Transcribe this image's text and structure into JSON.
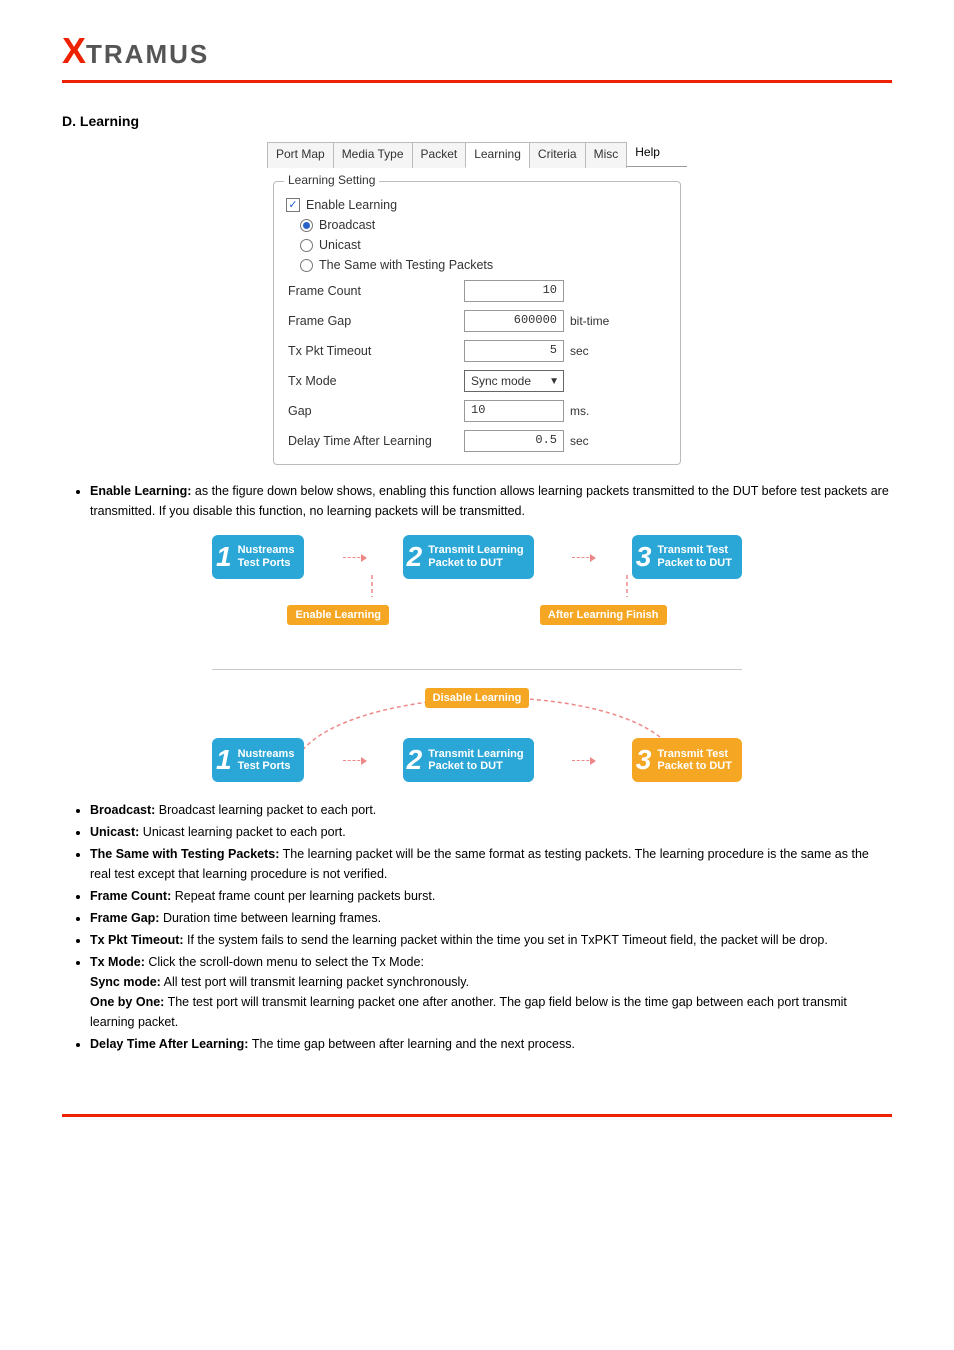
{
  "logo": {
    "x": "X",
    "rest": "TRAMUS"
  },
  "heading": "D. Learning",
  "fieldset_title": "Learning Setting",
  "tabs": {
    "items": [
      {
        "label": "Port Map",
        "active": false
      },
      {
        "label": "Media Type",
        "active": false
      },
      {
        "label": "Packet",
        "active": false
      },
      {
        "label": "Learning",
        "active": true
      },
      {
        "label": "Criteria",
        "active": false
      },
      {
        "label": "Misc",
        "active": false
      }
    ],
    "help": "Help"
  },
  "form": {
    "enable_learning": {
      "label": "Enable Learning",
      "checked": true
    },
    "radios": {
      "broadcast": "Broadcast",
      "unicast": "Unicast",
      "same_as_testing": "The Same with Testing Packets",
      "selected": "broadcast"
    },
    "rows": {
      "frame_count": {
        "label": "Frame Count",
        "value": "10",
        "unit": ""
      },
      "frame_gap": {
        "label": "Frame Gap",
        "value": "600000",
        "unit": "bit-time"
      },
      "tx_pkt_timeout": {
        "label": "Tx Pkt Timeout",
        "value": "5",
        "unit": "sec"
      },
      "tx_mode": {
        "label": "Tx Mode",
        "value": "Sync mode"
      },
      "gap": {
        "label": "Gap",
        "value": "10",
        "unit": "ms."
      },
      "delay_after": {
        "label": "Delay Time After Learning",
        "value": "0.5",
        "unit": "sec"
      }
    }
  },
  "flow": {
    "box1": "Nustreams\nTest Ports",
    "box2": "Transmit Learning\nPacket to DUT",
    "box3": "Transmit Test\nPacket to DUT",
    "enable": "Enable Learning",
    "after": "After Learning Finish",
    "disable": "Disable Learning"
  },
  "bullets": {
    "enable_lead": "Enable Learning: ",
    "enable_body": "as the figure down below shows, enabling this function allows learning packets transmitted to the DUT before test packets are transmitted. If you disable this function, no learning packets will be transmitted.",
    "b_broadcast_head": "Broadcast: ",
    "b_broadcast_body": "Broadcast learning packet to each port.",
    "b_unicast_head": "Unicast: ",
    "b_unicast_body": "Unicast learning packet to each port.",
    "b_same_head": "The Same with Testing Packets:",
    "b_same_body": " The learning packet will be the same format as testing packets. The learning procedure is the same as the real test except that learning procedure is not verified.",
    "b_frame_count_head": "Frame Count: ",
    "b_frame_count_body": "Repeat frame count per learning packets burst.",
    "b_frame_gap_head": "Frame Gap: ",
    "b_frame_gap_body": "Duration time between learning frames.",
    "b_tx_timeout_head": "Tx Pkt Timeout: ",
    "b_tx_timeout_body": "If the system fails to send the learning packet within the time you set in TxPKT Timeout field, the packet will be drop.",
    "b_tx_mode_head": "Tx Mode: ",
    "b_tx_mode_body": "Click the scroll-down menu to select the Tx Mode:",
    "b_tx_mode_sync_head": "Sync mode:",
    "b_tx_mode_sync_body": " All test port will transmit learning packet synchronously.",
    "b_tx_mode_one_head": "One by One:",
    "b_tx_mode_one_body": " The test port will transmit learning packet one after another. The gap field below is the time gap between each port transmit learning packet.",
    "b_delay_head": "Delay Time After Learning: ",
    "b_delay_body": "The time gap between after learning and the next process."
  }
}
